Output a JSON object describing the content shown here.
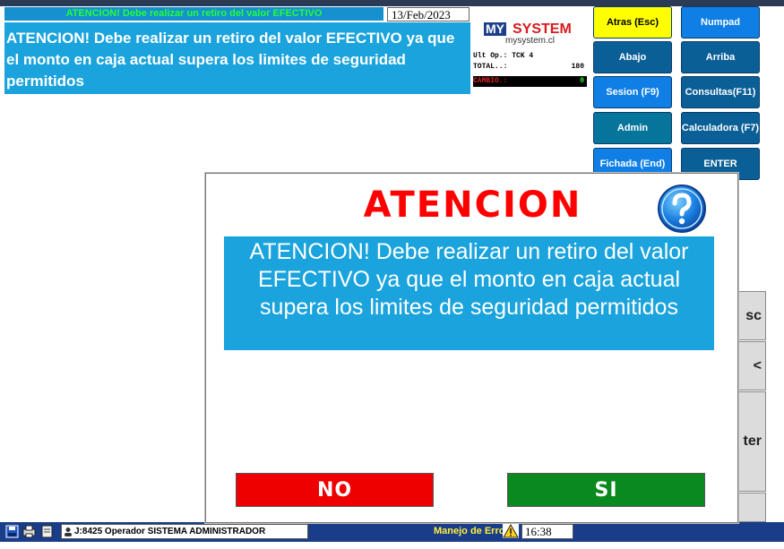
{
  "header": {
    "ticker": "ATENCION! Debe realizar un retiro del valor EFECTIVO",
    "date": "13/Feb/2023",
    "message": "ATENCION! Debe realizar un retiro del valor EFECTIVO ya que el monto en caja actual supera los limites de seguridad permitidos"
  },
  "logo": {
    "my": "MY",
    "system": "SYSTEM",
    "url": "mysystem.cl"
  },
  "info": {
    "ult_op_label": "Ult Op.: TCK 4",
    "total_label": "TOTAL..:",
    "total_value": "180",
    "cambio_label": "CAMBIO.:",
    "cambio_value": "0"
  },
  "buttons": {
    "atras": "Atras (Esc)",
    "numpad": "Numpad",
    "abajo": "Abajo",
    "arriba": "Arriba",
    "sesion": "Sesion (F9)",
    "consultas": "Consultas(F11)",
    "admin": "Admin",
    "calculadora": "Calculadora (F7)",
    "fichada": "Fichada (End)",
    "enter": "ENTER"
  },
  "sidekeys": {
    "esc": "sc",
    "back": "<",
    "enter": "ter"
  },
  "status": {
    "operator": "J:8425 Operador  SISTEMA ADMINISTRADOR",
    "error_label": "Manejo de Error",
    "time": "16:38"
  },
  "dialog": {
    "title": "ATENCION",
    "message": "ATENCION! Debe realizar un retiro del valor EFECTIVO ya que el monto en caja actual supera los limites de seguridad permitidos",
    "no_label": "NO",
    "si_label": "SI"
  },
  "colors": {
    "accent": "#1aa3dc",
    "no": "#ee0000",
    "si": "#0a8a1e",
    "title": "#ff0000"
  }
}
